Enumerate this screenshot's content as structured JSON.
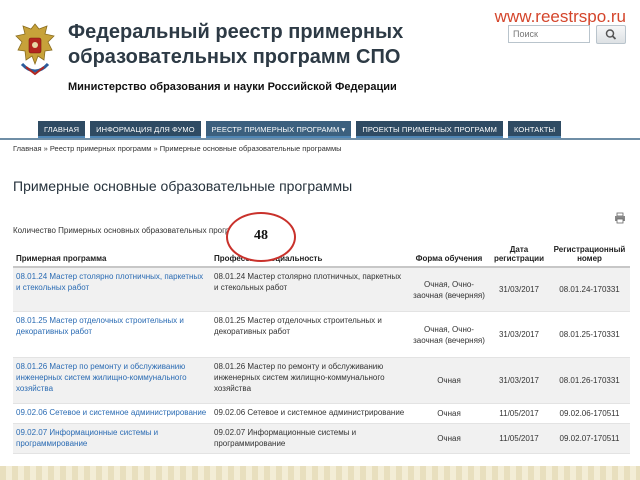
{
  "site_url": "www.reestrspo.ru",
  "search": {
    "placeholder": "Поиск"
  },
  "header": {
    "title_line1": "Федеральный реестр примерных",
    "title_line2": "образовательных программ СПО",
    "ministry": "Министерство образования и науки Российской Федерации"
  },
  "nav": [
    {
      "label": "ГЛАВНАЯ"
    },
    {
      "label": "ИНФОРМАЦИЯ ДЛЯ ФУМО"
    },
    {
      "label": "РЕЕСТР ПРИМЕРНЫХ ПРОГРАММ ▾"
    },
    {
      "label": "ПРОЕКТЫ ПРИМЕРНЫХ ПРОГРАММ"
    },
    {
      "label": "КОНТАКТЫ"
    }
  ],
  "breadcrumb": "Главная » Реестр примерных программ » Примерные основные образовательные программы",
  "page_title": "Примерные основные образовательные программы",
  "count_label": "Количество Примерных основных образовательных програм",
  "count_value": "48",
  "columns": {
    "program": "Примерная программа",
    "profession": "Профессия/специальность",
    "form": "Форма обучения",
    "date": "Дата регистрации",
    "reg": "Регистрационный номер"
  },
  "rows": [
    {
      "program": "08.01.24 Мастер столярно плотничных, паркетных и стекольных работ",
      "profession": "08.01.24 Мастер столярно плотничных, паркетных и стекольных работ",
      "form": "Очная, Очно-заочная (вечерняя)",
      "date": "31/03/2017",
      "reg": "08.01.24-170331"
    },
    {
      "program": "08.01.25 Мастер отделочных строительных и декоративных работ",
      "profession": "08.01.25 Мастер отделочных строительных и декоративных работ",
      "form": "Очная, Очно-заочная (вечерняя)",
      "date": "31/03/2017",
      "reg": "08.01.25-170331"
    },
    {
      "program": "08.01.26 Мастер по ремонту и обслуживанию инженерных систем жилищно-коммунального хозяйства",
      "profession": "08.01.26 Мастер по ремонту и обслуживанию инженерных систем жилищно-коммунального хозяйства",
      "form": "Очная",
      "date": "31/03/2017",
      "reg": "08.01.26-170331"
    },
    {
      "program": "09.02.06 Сетевое и системное администрирование",
      "profession": "09.02.06 Сетевое и системное администрирование",
      "form": "Очная",
      "date": "11/05/2017",
      "reg": "09.02.06-170511"
    },
    {
      "program": "09.02.07 Информационные системы и программирование",
      "profession": "09.02.07 Информационные системы и программирование",
      "form": "Очная",
      "date": "11/05/2017",
      "reg": "09.02.07-170511"
    }
  ]
}
